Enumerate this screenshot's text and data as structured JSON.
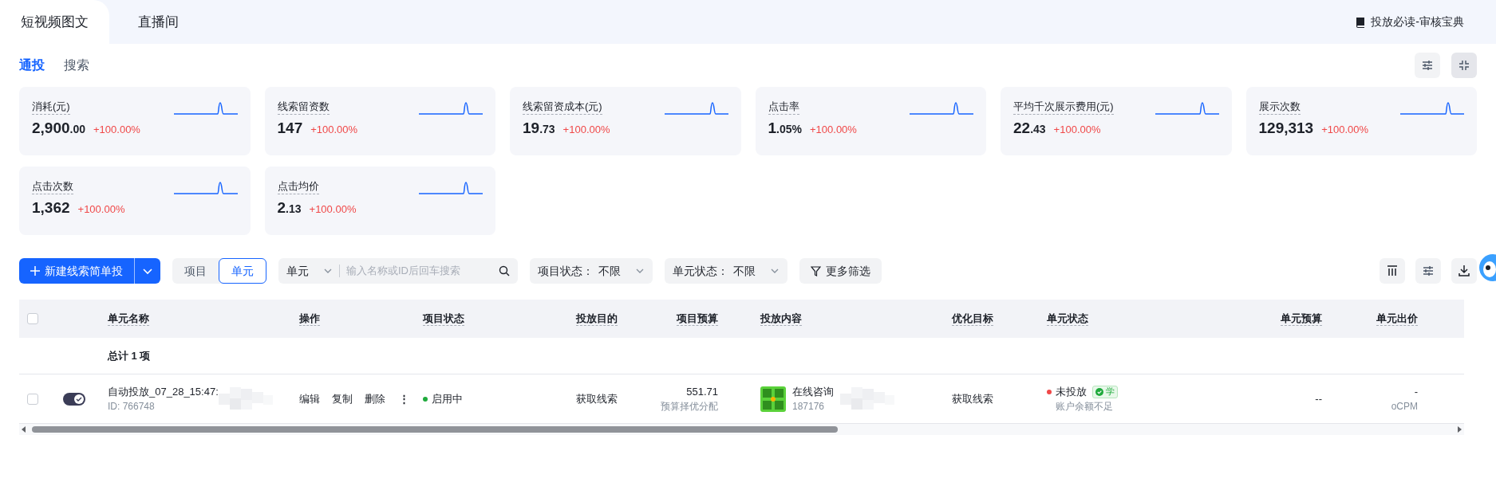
{
  "top_tabs": [
    {
      "label": "短视频图文",
      "selected": true
    },
    {
      "label": "直播间",
      "selected": false
    }
  ],
  "guide_link": "投放必读-审核宝典",
  "sub_tabs": [
    {
      "label": "通投",
      "selected": true
    },
    {
      "label": "搜索",
      "selected": false
    }
  ],
  "metric_cards": [
    {
      "label": "消耗(元)",
      "value": "2,900",
      "value_fraction": ".00",
      "change": "+100.00%"
    },
    {
      "label": "线索留资数",
      "value": "147",
      "change": "+100.00%"
    },
    {
      "label": "线索留资成本(元)",
      "value": "19",
      "value_fraction": ".73",
      "change": "+100.00%"
    },
    {
      "label": "点击率",
      "value": "1",
      "value_fraction": ".05%",
      "change": "+100.00%"
    },
    {
      "label": "平均千次展示费用(元)",
      "value": "22",
      "value_fraction": ".43",
      "change": "+100.00%"
    },
    {
      "label": "展示次数",
      "value": "129,313",
      "change": "+100.00%"
    },
    {
      "label": "点击次数",
      "value": "1,362",
      "change": "+100.00%"
    },
    {
      "label": "点击均价",
      "value": "2",
      "value_fraction": ".13",
      "change": "+100.00%"
    }
  ],
  "toolbar": {
    "create_button": "新建线索简单投",
    "level_switch": [
      {
        "label": "项目",
        "selected": false
      },
      {
        "label": "单元",
        "selected": true
      }
    ],
    "search": {
      "scope": "单元",
      "placeholder": "输入名称或ID后回车搜索"
    },
    "filters": [
      {
        "label": "项目状态：",
        "value": "不限"
      },
      {
        "label": "单元状态：",
        "value": "不限"
      }
    ],
    "more_filters": "更多筛选"
  },
  "table": {
    "select_all_checked": false,
    "columns": [
      "单元名称",
      "操作",
      "项目状态",
      "投放目的",
      "项目预算",
      "投放内容",
      "优化目标",
      "单元状态",
      "单元预算",
      "单元出价"
    ],
    "summary": "总计 1 项",
    "rows": [
      {
        "checked": false,
        "enabled": true,
        "name": "自动投放_07_28_15:47:",
        "id": "ID: 766748",
        "actions": [
          "编辑",
          "复制",
          "删除"
        ],
        "more": "⋮",
        "project_status": {
          "text": "启用中",
          "color": "#1faa3c"
        },
        "purpose": "获取线索",
        "budget": "551.71",
        "budget_note": "预算择优分配",
        "content_title": "在线咨询",
        "content_id": "187176",
        "optimize": "获取线索",
        "unit_status": {
          "text": "未投放",
          "color": "#f04848",
          "badge": "学",
          "note": "账户余额不足"
        },
        "unit_budget": "--",
        "unit_bid": "-",
        "bid_type": "oCPM"
      }
    ]
  }
}
